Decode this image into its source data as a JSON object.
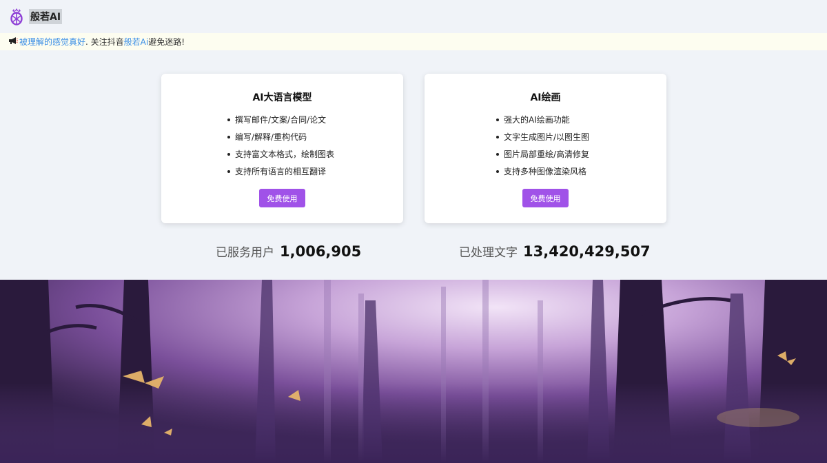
{
  "header": {
    "brand": "般若AI",
    "logo_icon": "pineapple-logo-icon"
  },
  "notice": {
    "icon": "megaphone-icon",
    "part1": "被理解的感觉真好",
    "part2": ". 关注抖音",
    "part3": "般若Ai",
    "part4": "避免迷路!"
  },
  "cards": [
    {
      "title": "AI大语言模型",
      "features": [
        "撰写邮件/文案/合同/论文",
        "编写/解释/重构代码",
        "支持富文本格式，绘制图表",
        "支持所有语言的相互翻译"
      ],
      "button": "免费使用"
    },
    {
      "title": "AI绘画",
      "features": [
        "强大的AI绘画功能",
        "文字生成图片/以图生图",
        "图片局部重绘/高清修复",
        "支持多种图像渲染风格"
      ],
      "button": "免费使用"
    }
  ],
  "stats": {
    "users_label": "已服务用户",
    "users_value": "1,006,905",
    "chars_label": "已处理文字",
    "chars_value": "13,420,429,507"
  },
  "colors": {
    "accent": "#a052e8",
    "link": "#3a8ee6",
    "background": "#f0f3f8"
  }
}
